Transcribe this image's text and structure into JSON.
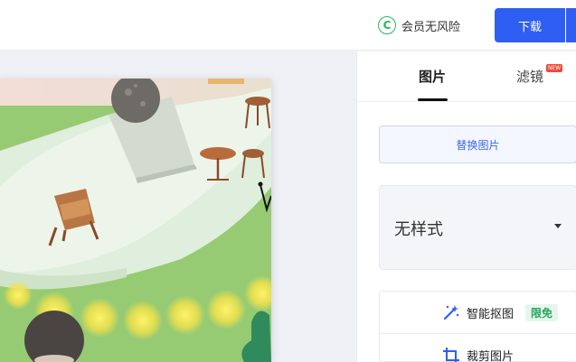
{
  "topbar": {
    "vip_icon_glyph": "C",
    "vip_label": "会员无风险",
    "download_label": "下载"
  },
  "panel": {
    "tabs": [
      {
        "label": "图片",
        "active": true
      },
      {
        "label": "滤镜",
        "badge": "NEW"
      }
    ],
    "replace_button_label": "替换图片",
    "style_select": {
      "value": "无样式"
    },
    "tools": [
      {
        "label": "智能抠图",
        "badge": "限免",
        "icon": "magic-wand-icon"
      },
      {
        "label": "裁剪图片",
        "icon": "crop-icon"
      }
    ]
  },
  "colors": {
    "primary": "#2f5ff2",
    "vip_green": "#2bb463",
    "free_green": "#27a55b",
    "new_red": "#f04b3a"
  }
}
